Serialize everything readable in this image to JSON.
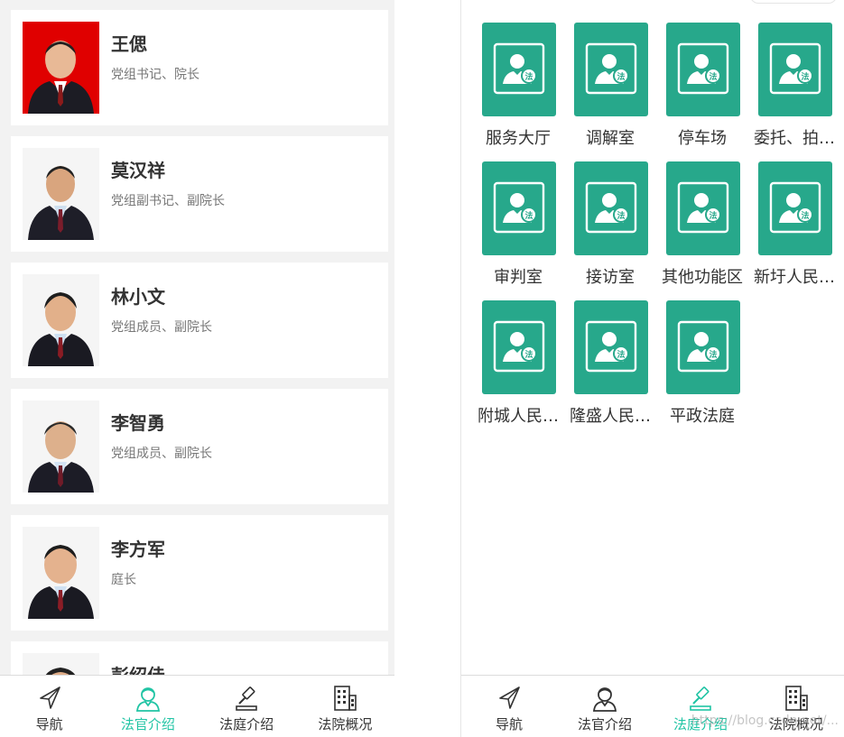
{
  "left_screen": {
    "judges": [
      {
        "name": "王偲",
        "title": "党组书记、院长"
      },
      {
        "name": "莫汉祥",
        "title": "党组副书记、副院长"
      },
      {
        "name": "林小文",
        "title": "党组成员、副院长"
      },
      {
        "name": "李智勇",
        "title": "党组成员、副院长"
      },
      {
        "name": "李方军",
        "title": "庭长"
      },
      {
        "name": "彭绍佳",
        "title": ""
      }
    ],
    "tabbar": {
      "tabs": [
        {
          "label": "导航",
          "icon": "navigation-arrow-icon"
        },
        {
          "label": "法官介绍",
          "icon": "judge-person-icon"
        },
        {
          "label": "法庭介绍",
          "icon": "gavel-icon"
        },
        {
          "label": "法院概况",
          "icon": "building-icon"
        }
      ],
      "active": "法官介绍"
    }
  },
  "right_screen": {
    "courts": [
      {
        "label": "服务大厅",
        "icon": "court-judge-icon"
      },
      {
        "label": "调解室",
        "icon": "court-judge-icon"
      },
      {
        "label": "停车场",
        "icon": "court-judge-icon"
      },
      {
        "label": "委托、拍…",
        "icon": "court-judge-icon"
      },
      {
        "label": "审判室",
        "icon": "court-judge-icon"
      },
      {
        "label": "接访室",
        "icon": "court-judge-icon"
      },
      {
        "label": "其他功能区",
        "icon": "court-judge-icon"
      },
      {
        "label": "新圩人民…",
        "icon": "court-judge-icon"
      },
      {
        "label": "附城人民…",
        "icon": "court-judge-icon"
      },
      {
        "label": "隆盛人民…",
        "icon": "court-judge-icon"
      },
      {
        "label": "平政法庭",
        "icon": "court-judge-icon"
      }
    ],
    "tile_badge": "法",
    "tabbar": {
      "tabs": [
        {
          "label": "导航",
          "icon": "navigation-arrow-icon"
        },
        {
          "label": "法官介绍",
          "icon": "judge-person-icon"
        },
        {
          "label": "法庭介绍",
          "icon": "gavel-icon"
        },
        {
          "label": "法院概况",
          "icon": "building-icon"
        }
      ],
      "active": "法庭介绍"
    },
    "watermark": "https://blog.csdn.net/..."
  },
  "colors": {
    "accent": "#20c4a4",
    "tile": "#27a88b",
    "background": "#f2f2f2",
    "photo_bg_red": "#e00000",
    "photo_bg_white": "#f5f5f5"
  }
}
